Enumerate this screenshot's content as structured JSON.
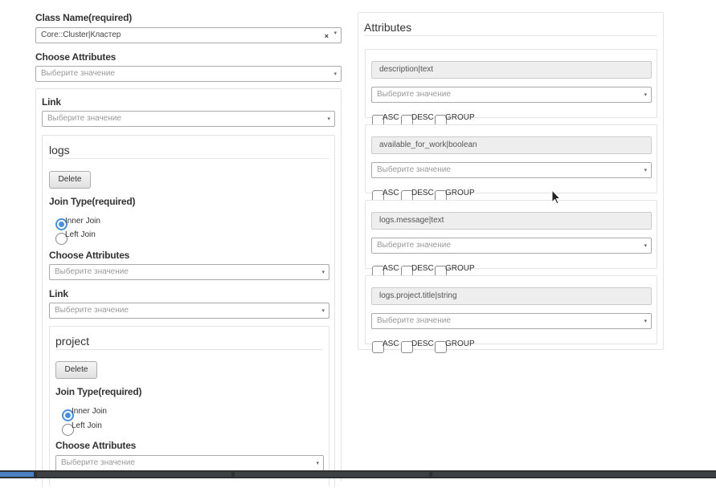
{
  "left": {
    "class_name": {
      "label": "Class Name(required)",
      "value": "Core::Cluster|Кластер"
    },
    "choose_attributes": {
      "label": "Choose Attributes",
      "placeholder": "Выберите значение"
    },
    "link_block": {
      "label": "Link",
      "placeholder": "Выберите значение",
      "logs": {
        "title": "logs",
        "delete_label": "Delete",
        "join_type_label": "Join Type(required)",
        "inner_join": "Inner Join",
        "left_join": "Left Join",
        "inner_selected": true,
        "choose_attributes_label": "Choose Attributes",
        "choose_attributes_placeholder": "Выберите значение",
        "link_label": "Link",
        "link_placeholder": "Выберите значение",
        "project": {
          "title": "project",
          "delete_label": "Delete",
          "join_type_label": "Join Type(required)",
          "inner_join": "Inner Join",
          "left_join": "Left Join",
          "inner_selected": true,
          "choose_attributes_label": "Choose Attributes",
          "choose_attributes_placeholder": "Выберите значение"
        }
      }
    }
  },
  "right": {
    "title": "Attributes",
    "items": [
      {
        "name": "description|text",
        "placeholder": "Выберите значение",
        "asc": "ASC",
        "desc": "DESC",
        "group": "GROUP"
      },
      {
        "name": "available_for_work|boolean",
        "placeholder": "Выберите значение",
        "asc": "ASC",
        "desc": "DESC",
        "group": "GROUP"
      },
      {
        "name": "logs.message|text",
        "placeholder": "Выберите значение",
        "asc": "ASC",
        "desc": "DESC",
        "group": "GROUP"
      },
      {
        "name": "logs.project.title|string",
        "placeholder": "Выберите значение",
        "asc": "ASC",
        "desc": "DESC",
        "group": "GROUP"
      }
    ]
  },
  "icons": {
    "caret": "caret-down-icon",
    "clear": "clear-x-icon",
    "cursor": "mouse-cursor-icon"
  },
  "colors": {
    "radio_accent": "#4a90d9",
    "readonly_bg": "#eeeeee",
    "taskbar": "#2e3133"
  }
}
